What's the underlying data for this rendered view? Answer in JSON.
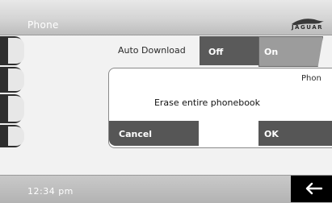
{
  "header": {
    "title": "Phone",
    "logo_text": "JAGUAR"
  },
  "setting": {
    "label": "Auto Download",
    "options": [
      "Off",
      "On"
    ]
  },
  "dialog": {
    "partial_title": "Phon",
    "message": "Erase entire phonebook",
    "cancel_label": "Cancel",
    "ok_label": "OK"
  },
  "footer": {
    "time": "12:34 pm"
  },
  "icons": {
    "back": "back-arrow-icon",
    "logo": "jaguar-leaper-logo"
  },
  "colors": {
    "dark_button": "#565656",
    "selected_segment": "#5a5a5a",
    "accent_white": "#ffffff"
  }
}
